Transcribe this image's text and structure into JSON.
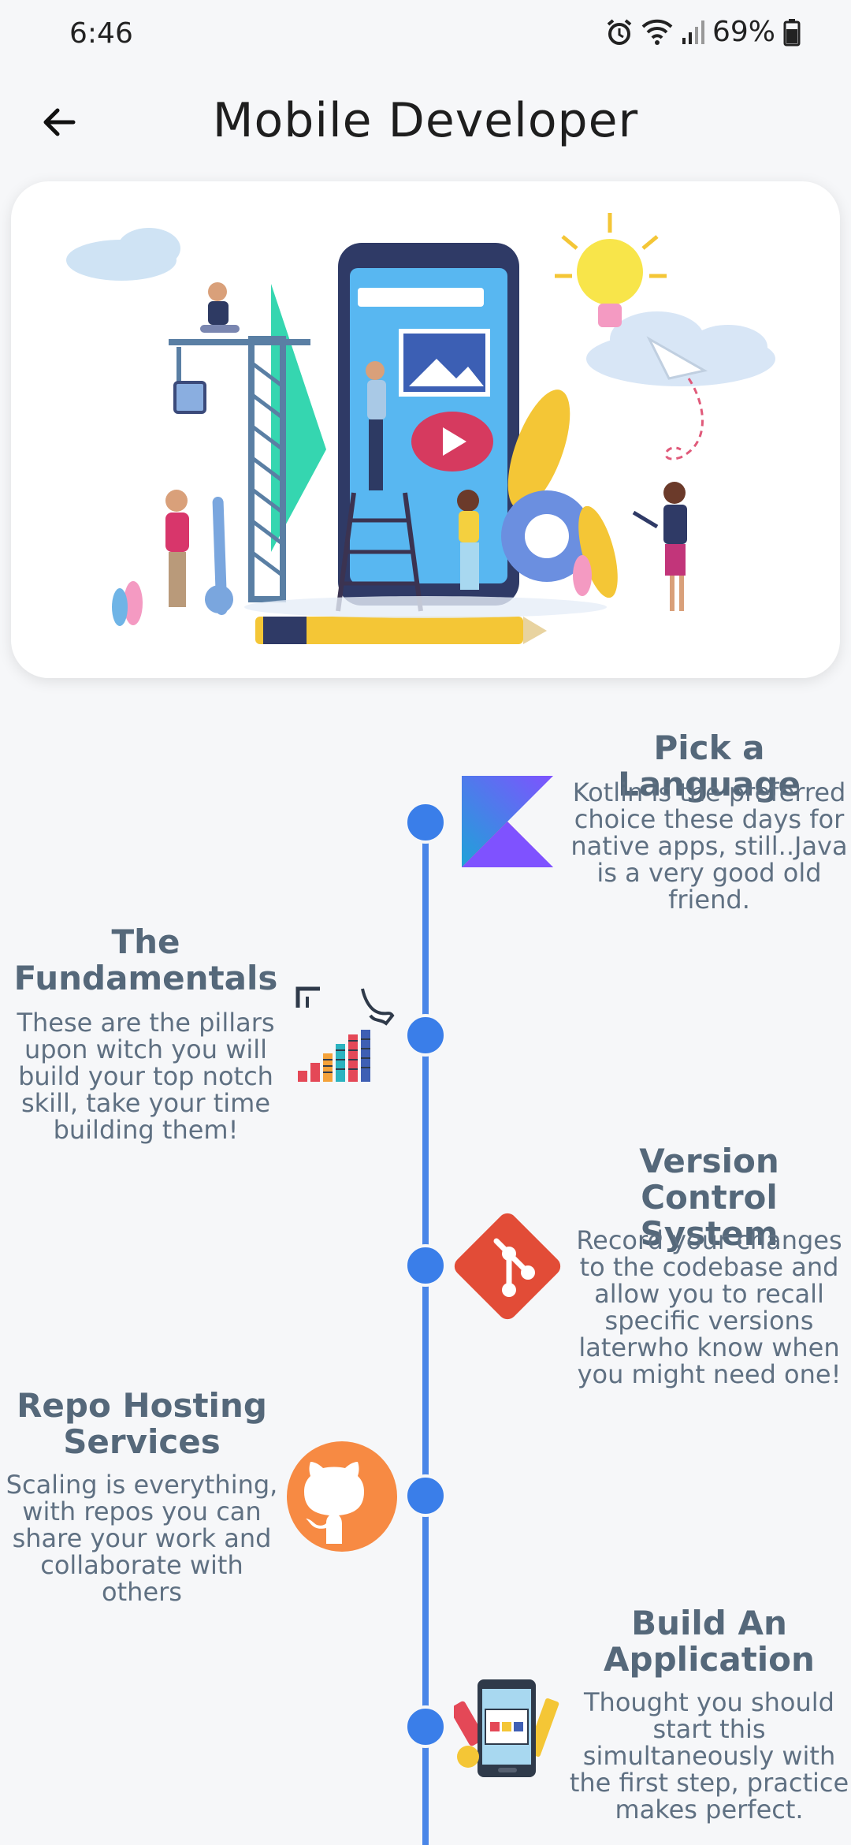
{
  "status": {
    "time": "6:46",
    "battery": "69%"
  },
  "header": {
    "title": "Mobile Developer"
  },
  "steps": [
    {
      "title": "Pick a Language",
      "description": "Kotlin is the preferred choice these days for native apps, still..Java is a very good old friend.",
      "icon": "kotlin-logo-icon"
    },
    {
      "title": "The Fundamentals",
      "description": "These are the pillars upon witch you will build your top notch skill, take your time building them!",
      "icon": "skills-chart-icon"
    },
    {
      "title": "Version Control System",
      "description": "Record your changes to the codebase and allow you to recall specific versions laterwho know when you might need one!",
      "icon": "git-logo-icon"
    },
    {
      "title": "Repo Hosting Services",
      "description": "Scaling is everything, with repos you can share your work and collaborate with others",
      "icon": "github-logo-icon"
    },
    {
      "title": "Build An Application",
      "description": "Thought you should start this simultaneously with the first step, practice makes perfect.",
      "icon": "mobile-app-icon"
    }
  ],
  "colors": {
    "timeline": "#3a7ee9",
    "text_title": "#55687a",
    "text_body": "#5f7082"
  }
}
